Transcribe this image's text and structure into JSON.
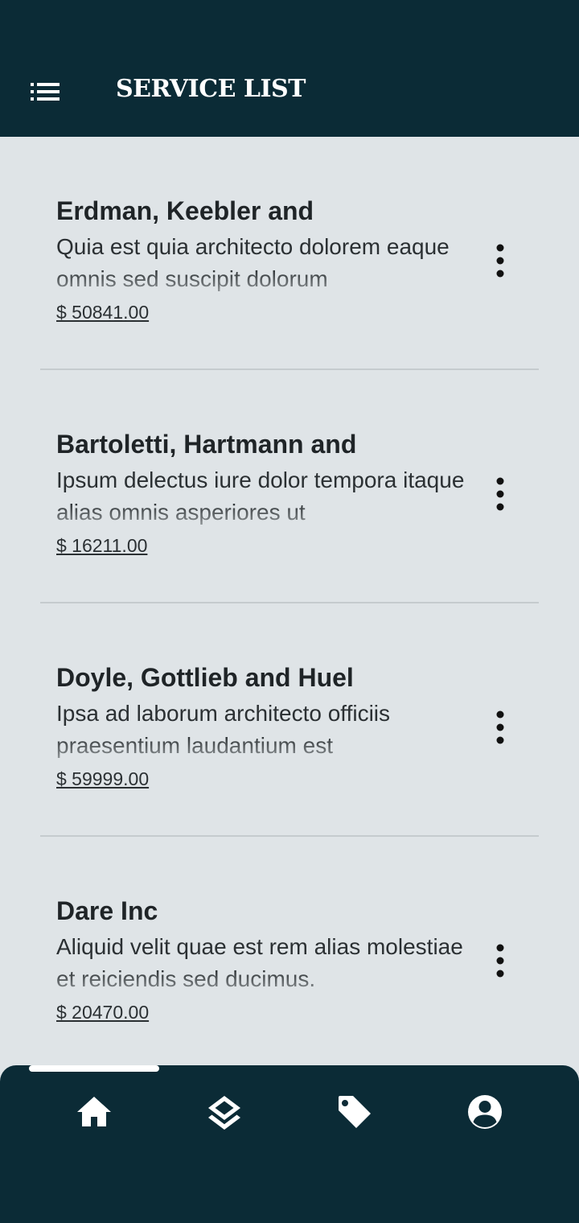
{
  "header": {
    "title": "SERVICE LIST",
    "menu_icon": "hamburger-menu-icon"
  },
  "services": [
    {
      "name": "Erdman, Keebler and",
      "description": "Quia est quia architecto dolorem eaque omnis sed suscipit dolorum",
      "price": "$ 50841.00"
    },
    {
      "name": "Bartoletti, Hartmann and",
      "description": "Ipsum delectus iure dolor tempora itaque alias omnis asperiores ut",
      "price": "$ 16211.00"
    },
    {
      "name": "Doyle, Gottlieb and Huel",
      "description": "Ipsa ad laborum architecto officiis praesentium laudantium est",
      "price": "$ 59999.00"
    },
    {
      "name": "Dare Inc",
      "description": "Aliquid velit quae est rem alias molestiae et reiciendis sed ducimus.",
      "price": "$ 20470.00"
    }
  ],
  "bottom_nav": {
    "items": [
      {
        "icon": "home-icon",
        "active": true
      },
      {
        "icon": "layers-icon",
        "active": false
      },
      {
        "icon": "tag-icon",
        "active": false
      },
      {
        "icon": "account-circle-icon",
        "active": false
      }
    ]
  },
  "colors": {
    "primary": "#0b2b36",
    "background": "#dfe4e7",
    "text": "#1f2427",
    "on_primary": "#ffffff"
  }
}
